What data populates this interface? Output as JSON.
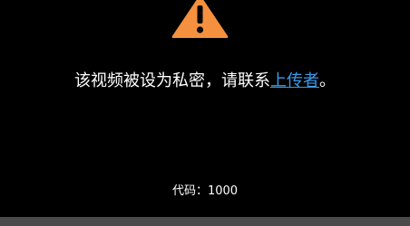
{
  "error": {
    "message_prefix": "该视频被设为私密，请联系",
    "link_label": "上传者",
    "message_suffix": "。",
    "code_label": "代码：",
    "code_value": "1000"
  },
  "icons": {
    "warning": "warning-triangle-icon"
  },
  "colors": {
    "background": "#000000",
    "warning_icon": "#f5913e",
    "link": "#3d9ae8",
    "text": "#ffffff",
    "bottom_bar": "#4a4a4a"
  }
}
